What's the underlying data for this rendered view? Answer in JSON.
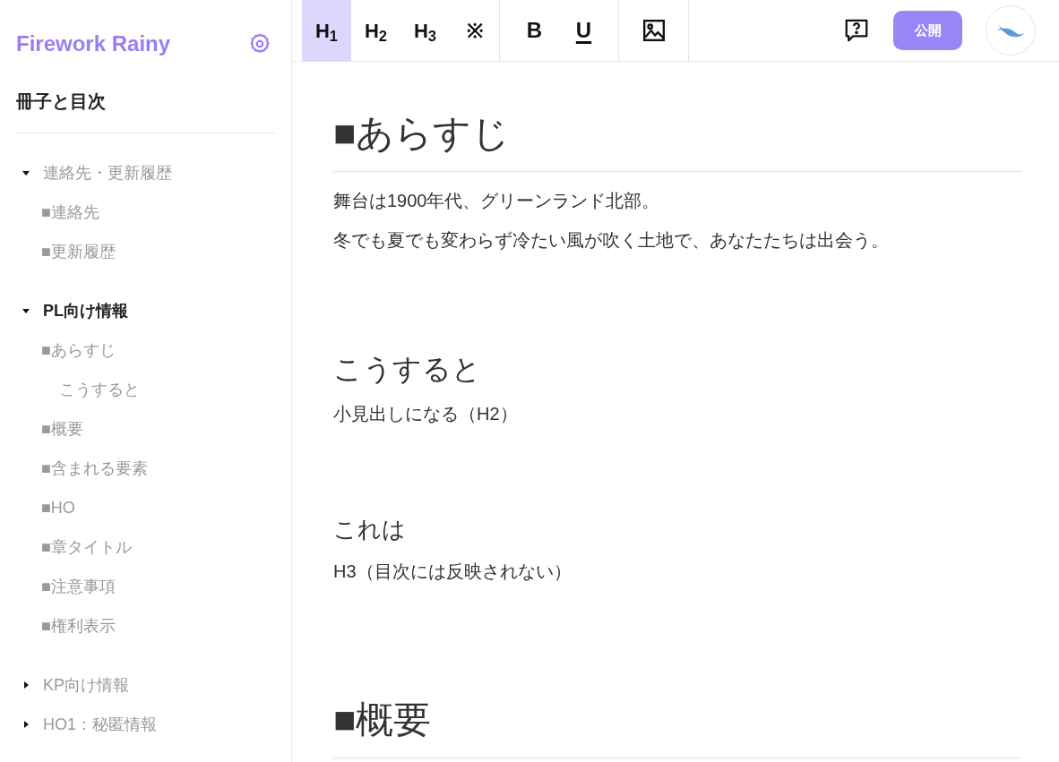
{
  "sidebar": {
    "app_title": "Firework Rainy",
    "section_title": "冊子と目次",
    "groups": [
      {
        "label": "連絡先・更新履歴",
        "expanded": true,
        "selected": false,
        "children": [
          {
            "label": "■連絡先"
          },
          {
            "label": "■更新履歴"
          }
        ]
      },
      {
        "label": "PL向け情報",
        "expanded": true,
        "selected": true,
        "children": [
          {
            "label": "■あらすじ",
            "children": [
              {
                "label": "こうすると"
              }
            ]
          },
          {
            "label": "■概要"
          },
          {
            "label": "■含まれる要素"
          },
          {
            "label": "■HO"
          },
          {
            "label": "■章タイトル"
          },
          {
            "label": "■注意事項"
          },
          {
            "label": "■権利表示"
          }
        ]
      },
      {
        "label": "KP向け情報",
        "expanded": false,
        "selected": false
      },
      {
        "label": "HO1：秘匿情報",
        "expanded": false,
        "selected": false
      }
    ]
  },
  "toolbar": {
    "groups": [
      [
        {
          "kind": "text",
          "label": "H$_{1}$",
          "selected": true
        },
        {
          "kind": "text",
          "label": "H$_{2}$",
          "selected": false
        },
        {
          "kind": "text",
          "label": "H$_{3}$",
          "selected": false
        },
        {
          "kind": "text",
          "label": "※",
          "selected": false
        }
      ],
      [
        {
          "kind": "bold",
          "label": "B",
          "selected": false
        },
        {
          "kind": "underline",
          "label": "U",
          "selected": false
        }
      ],
      [
        {
          "kind": "image",
          "selected": false
        }
      ]
    ],
    "publish_button": "公開"
  },
  "document": [
    {
      "kind": "h1",
      "text": "■あらすじ"
    },
    {
      "kind": "p",
      "text": "舞台は1900年代、グリーンランド北部。"
    },
    {
      "kind": "p",
      "text": "冬でも夏でも変わらず冷たい風が吹く土地で、あなたたちは出会う。"
    },
    {
      "kind": "h2",
      "text": "こうすると"
    },
    {
      "kind": "p",
      "text": "小見出しになる（H2）"
    },
    {
      "kind": "h3",
      "text": "これは"
    },
    {
      "kind": "p",
      "text": "H3（目次には反映されない）"
    },
    {
      "kind": "h1",
      "text": "■概要"
    }
  ]
}
